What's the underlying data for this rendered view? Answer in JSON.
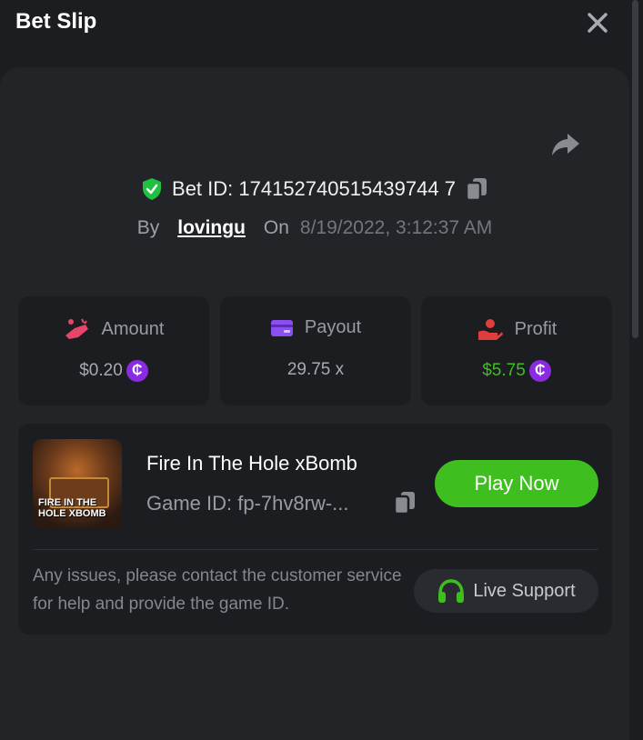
{
  "header": {
    "title": "Bet Slip"
  },
  "bet": {
    "id_text": "Bet ID: 174152740515439744 7",
    "by_label": "By",
    "username": "lovingu",
    "on_label": "On",
    "date": "8/19/2022, 3:12:37 AM"
  },
  "stats": {
    "amount": {
      "label": "Amount",
      "value": "$0.20"
    },
    "payout": {
      "label": "Payout",
      "value": "29.75 x"
    },
    "profit": {
      "label": "Profit",
      "value": "$5.75"
    }
  },
  "game": {
    "name": "Fire In The Hole xBomb",
    "id_text": "Game ID: fp-7hv8rw-...",
    "play_label": "Play Now",
    "thumb_text": "FIRE IN THE HOLE XBOMB"
  },
  "support": {
    "help_text": "Any issues, please contact the customer service for help and provide the game ID.",
    "button_label": "Live Support"
  },
  "colors": {
    "accent_green": "#3fbe1f",
    "profit_green": "#3fbe1f",
    "coin_purple": "#8a2be2",
    "shield_green": "#20c040",
    "amount_icon": "#e8456b",
    "payout_icon": "#8b4ef0",
    "profit_icon": "#e23d3d"
  },
  "icons": {
    "close": "close-icon",
    "share": "share-icon",
    "shield": "shield-check-icon",
    "copy": "copy-icon",
    "amount": "coins-hand-icon",
    "payout": "wallet-icon",
    "profit": "profit-hand-icon",
    "coin": "coin-icon",
    "support": "headset-icon"
  }
}
